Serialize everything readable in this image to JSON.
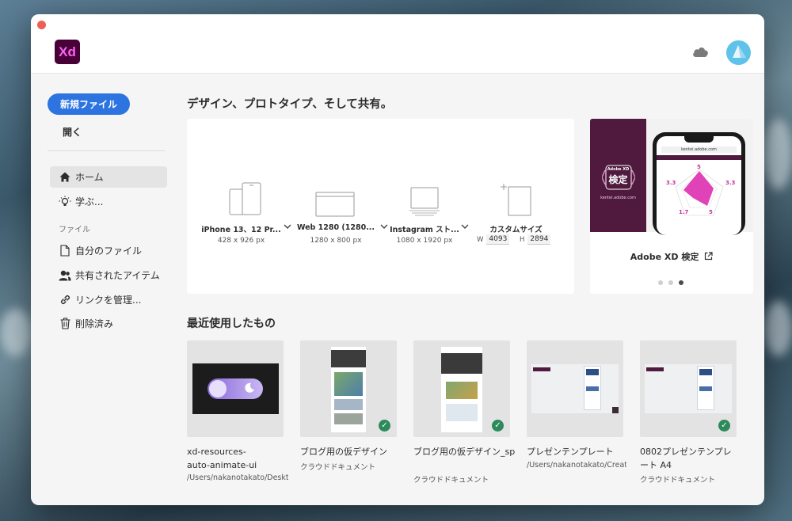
{
  "app": {
    "logo_text": "Xd",
    "brand_color": "#470137",
    "accent_color": "#2d74e0"
  },
  "topbar": {
    "cloud_icon": "cloud-icon",
    "avatar": "user-avatar"
  },
  "sidebar": {
    "new_file_label": "新規ファイル",
    "open_label": "開く",
    "items": [
      {
        "label": "ホーム",
        "icon": "home-icon",
        "active": true
      },
      {
        "label": "学ぶ...",
        "icon": "lightbulb-icon",
        "active": false
      }
    ],
    "files_section_label": "ファイル",
    "file_items": [
      {
        "label": "自分のファイル",
        "icon": "document-icon"
      },
      {
        "label": "共有されたアイテム",
        "icon": "shared-user-icon"
      },
      {
        "label": "リンクを管理...",
        "icon": "link-icon"
      },
      {
        "label": "削除済み",
        "icon": "trash-icon"
      }
    ]
  },
  "main": {
    "title": "デザイン、プロトタイプ、そして共有。",
    "presets": [
      {
        "name": "iPhone 13、12 Pr...",
        "size": "428 x 926 px"
      },
      {
        "name": "Web 1280 (1280...",
        "size": "1280 x 800 px"
      },
      {
        "name": "Instagram スト...",
        "size": "1080 x 1920 px"
      },
      {
        "name": "カスタムサイズ",
        "w_label": "W",
        "w_value": "4093",
        "h_label": "H",
        "h_value": "2894"
      }
    ],
    "promo": {
      "caption": "Adobe XD 検定",
      "badge_small": "Adobe XD",
      "badge_big": "検定",
      "url": "kentei.adobe.com",
      "screen_url": "kentei.adobe.com",
      "chart_values": [
        "5",
        "3.3",
        "3.3",
        "1.7",
        "5"
      ]
    },
    "recent_title": "最近使用したもの",
    "recent": [
      {
        "name": "xd-resources-auto-animate-ui",
        "path": "/Users/nakanotakato/Deskt...",
        "synced": false
      },
      {
        "name": "ブログ用の仮デザイン",
        "path": "クラウドドキュメント",
        "synced": true
      },
      {
        "name": "ブログ用の仮デザイン_sp",
        "path": "クラウドドキュメント",
        "synced": true
      },
      {
        "name": "プレゼンテンプレート",
        "path": "/Users/nakanotakato/Creat...",
        "synced": false
      },
      {
        "name": "0802プレゼンテンプレート A4",
        "path": "クラウドドキュメント",
        "synced": true
      }
    ]
  }
}
